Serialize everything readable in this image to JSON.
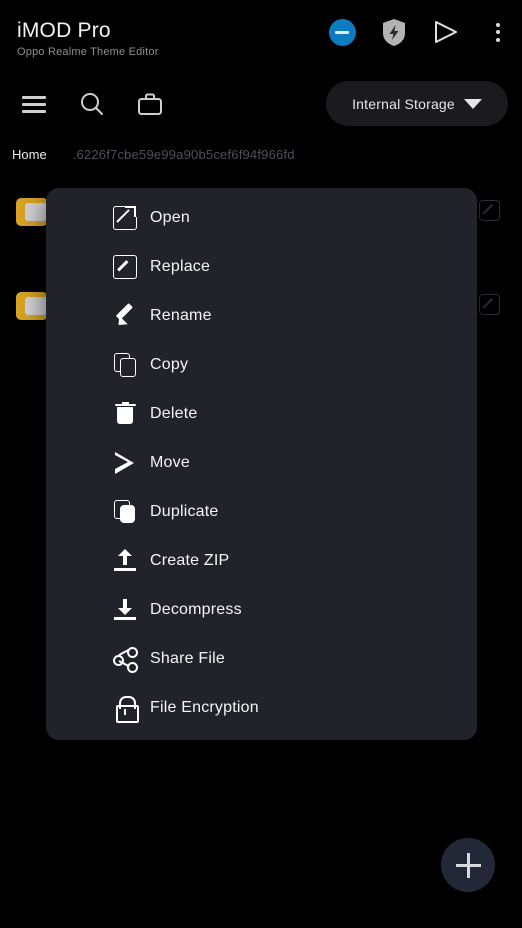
{
  "app": {
    "title": "iMOD Pro",
    "subtitle": "Oppo Realme Theme Editor"
  },
  "header": {
    "icons": [
      {
        "name": "minus-circle-icon",
        "glyph": "minus",
        "color": "#0c7cc0"
      },
      {
        "name": "shield-bolt-icon",
        "glyph": "shield",
        "color": "#b0b0b0"
      },
      {
        "name": "play-icon",
        "glyph": "play",
        "color": "#e0e0e0"
      },
      {
        "name": "overflow-menu-icon",
        "glyph": "dots",
        "color": "#d9d9d9"
      }
    ]
  },
  "toolbar": {
    "menu_icon": "hamburger-icon",
    "search_icon": "search-icon",
    "briefcase_icon": "briefcase-icon",
    "storage": {
      "label": "Internal Storage",
      "caret": "chevron-down-icon"
    }
  },
  "breadcrumb": {
    "home": "Home",
    "path": ".6226f7cbe59e99a90b5cef6f94f966fd"
  },
  "file_list": {
    "rows": [
      {
        "icon": "folder-icon",
        "edit_icon": "edit-icon"
      },
      {
        "icon": "folder-icon",
        "edit_icon": "edit-icon"
      }
    ]
  },
  "context_menu": {
    "background": "#22222b",
    "items": [
      {
        "label": "Open",
        "icon": "open-external-icon"
      },
      {
        "label": "Replace",
        "icon": "replace-icon"
      },
      {
        "label": "Rename",
        "icon": "pencil-icon"
      },
      {
        "label": "Copy",
        "icon": "copy-icon"
      },
      {
        "label": "Delete",
        "icon": "trash-icon"
      },
      {
        "label": "Move",
        "icon": "move-play-icon"
      },
      {
        "label": "Duplicate",
        "icon": "duplicate-icon"
      },
      {
        "label": "Create ZIP",
        "icon": "upload-icon"
      },
      {
        "label": "Decompress",
        "icon": "download-icon"
      },
      {
        "label": "Share File",
        "icon": "share-icon"
      },
      {
        "label": "File Encryption",
        "icon": "lock-icon"
      }
    ]
  },
  "fab": {
    "icon": "plus-icon",
    "color": "#232839"
  }
}
